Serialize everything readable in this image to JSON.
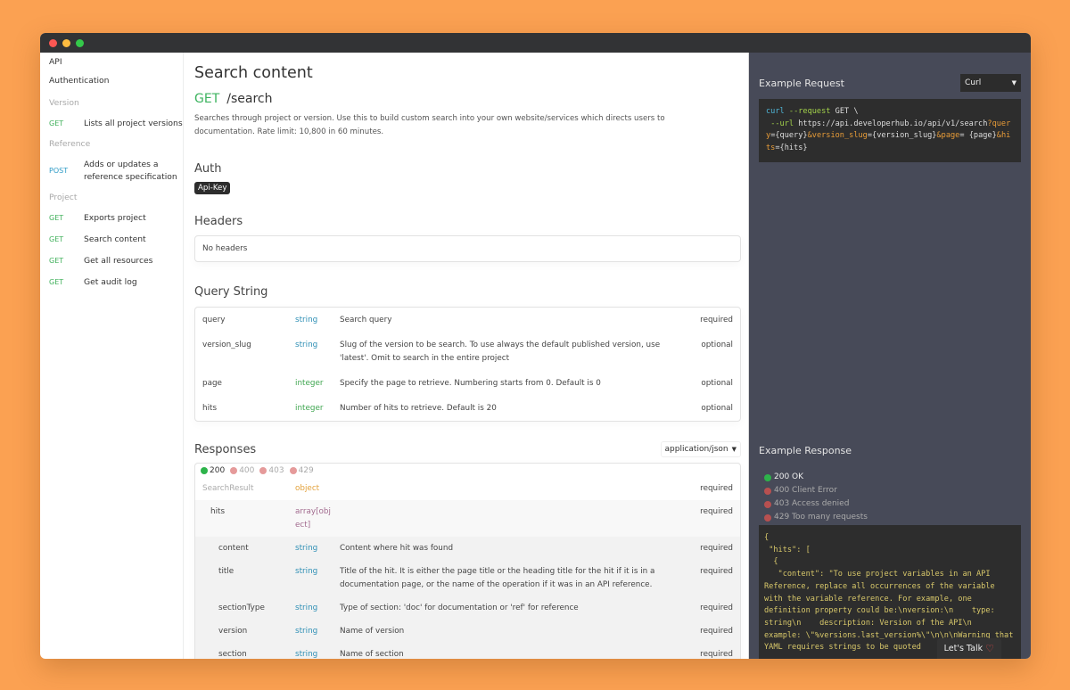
{
  "window": {
    "controls": [
      {
        "name": "close",
        "color": "#fc5753"
      },
      {
        "name": "minimize",
        "color": "#fdbc40"
      },
      {
        "name": "maximize",
        "color": "#34c84a"
      }
    ]
  },
  "sidebar": {
    "top_links": [
      "API",
      "Authentication"
    ],
    "sections": [
      {
        "title": "Version",
        "items": [
          {
            "method": "GET",
            "label": "Lists all project versions"
          }
        ]
      },
      {
        "title": "Reference",
        "items": [
          {
            "method": "POST",
            "label": "Adds or updates a reference specification"
          }
        ]
      },
      {
        "title": "Project",
        "items": [
          {
            "method": "GET",
            "label": "Exports project"
          },
          {
            "method": "GET",
            "label": "Search content"
          },
          {
            "method": "GET",
            "label": "Get all resources"
          },
          {
            "method": "GET",
            "label": "Get audit log"
          }
        ]
      }
    ]
  },
  "main": {
    "title": "Search content",
    "method": "GET",
    "path": "/search",
    "description": "Searches through project or version. Use this to build custom search into your own website/services which directs users to documentation. Rate limit: 10,800 in 60 minutes.",
    "auth": {
      "heading": "Auth",
      "badge": "Api-Key"
    },
    "headers": {
      "heading": "Headers",
      "empty_text": "No headers"
    },
    "query_string": {
      "heading": "Query String",
      "params": [
        {
          "name": "query",
          "type": "string",
          "description": "Search query",
          "requirement": "required"
        },
        {
          "name": "version_slug",
          "type": "string",
          "description": "Slug of the version to be search. To use always the default published version, use 'latest'. Omit to search in the entire project",
          "requirement": "optional"
        },
        {
          "name": "page",
          "type": "integer",
          "description": "Specify the page to retrieve. Numbering starts from 0. Default is 0",
          "requirement": "optional"
        },
        {
          "name": "hits",
          "type": "integer",
          "description": "Number of hits to retrieve. Default is 20",
          "requirement": "optional"
        }
      ]
    },
    "responses": {
      "heading": "Responses",
      "content_type": "application/json",
      "status_tabs": [
        {
          "code": "200",
          "color": "#2db34a",
          "active": true
        },
        {
          "code": "400",
          "color": "#e59a9a",
          "active": false
        },
        {
          "code": "403",
          "color": "#e59a9a",
          "active": false
        },
        {
          "code": "429",
          "color": "#e59a9a",
          "active": false
        }
      ],
      "fields": [
        {
          "name": "SearchResult",
          "type": "object",
          "description": "",
          "requirement": "required",
          "level": 0
        },
        {
          "name": "hits",
          "type": "array[object]",
          "description": "",
          "requirement": "required",
          "level": 1
        },
        {
          "name": "content",
          "type": "string",
          "description": "Content where hit was found",
          "requirement": "required",
          "level": 2
        },
        {
          "name": "title",
          "type": "string",
          "description": "Title of the hit. It is either the page title or the heading title for the hit if it is in a documentation page, or the name of the operation if it was in an API reference.",
          "requirement": "required",
          "level": 2
        },
        {
          "name": "sectionType",
          "type": "string",
          "description": "Type of section: 'doc' for documentation or 'ref' for reference",
          "requirement": "required",
          "level": 2
        },
        {
          "name": "version",
          "type": "string",
          "description": "Name of version",
          "requirement": "required",
          "level": 2
        },
        {
          "name": "section",
          "type": "string",
          "description": "Name of section",
          "requirement": "required",
          "level": 2
        }
      ]
    }
  },
  "right_panel": {
    "example_request": {
      "title": "Example Request",
      "language": "Curl",
      "code": {
        "line1_cmd": "curl",
        "line1_flag": "--request",
        "line1_rest": " GET \\",
        "line2_flag": "--url",
        "line2_url": " https://api.developerhub.io/api/v1/search",
        "q": "?",
        "p1": "query",
        "v1": "={query}",
        "p2": "&version_slug",
        "v2": "={version_slug}",
        "p3": "&page",
        "v3": "=",
        "v3b": "{page}",
        "p4": "&hits",
        "v4": "={hits}"
      }
    },
    "example_response": {
      "title": "Example Response",
      "statuses": [
        {
          "label": "200 OK",
          "color": "#2db34a",
          "active": true
        },
        {
          "label": "400 Client Error",
          "color": "#b85050",
          "active": false
        },
        {
          "label": "403 Access denied",
          "color": "#b85050",
          "active": false
        },
        {
          "label": "429 Too many requests",
          "color": "#b85050",
          "active": false
        }
      ],
      "code": "{\n \"hits\": [\n  {\n   \"content\": \"To use project variables in an API Reference, replace all occurrences of the variable with the variable reference. For example, one definition property could be:\\nversion:\\n    type: string\\n    description: Version of the API\\n    example: \\\"%versions.last_version%\\\"\\n\\n\\nWarning that YAML requires strings to be quoted"
    },
    "chat_button": "Let's Talk"
  }
}
